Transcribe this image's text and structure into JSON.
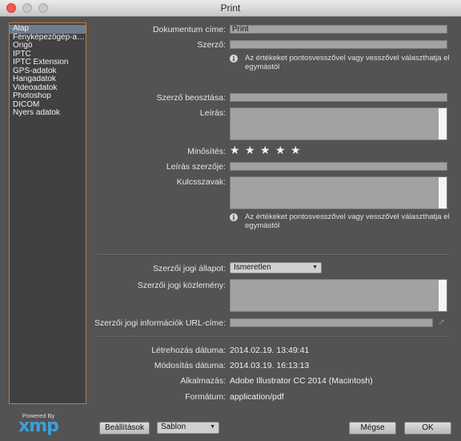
{
  "window": {
    "title": "Print"
  },
  "sidebar": {
    "items": [
      {
        "label": "Alap",
        "active": true
      },
      {
        "label": "Fényképezőgép-adatok",
        "active": false
      },
      {
        "label": "Origó",
        "active": false
      },
      {
        "label": "IPTC",
        "active": false
      },
      {
        "label": "IPTC Extension",
        "active": false
      },
      {
        "label": "GPS-adatok",
        "active": false
      },
      {
        "label": "Hangadatok",
        "active": false
      },
      {
        "label": "Videoadatok",
        "active": false
      },
      {
        "label": "Photoshop",
        "active": false
      },
      {
        "label": "DICOM",
        "active": false
      },
      {
        "label": "Nyers adatok",
        "active": false
      }
    ]
  },
  "form": {
    "doc_title_label": "Dokumentum címe:",
    "doc_title_value": "Print",
    "author_label": "Szerző:",
    "author_value": "",
    "info_text": "Az értékeket pontosvesszővel vagy vesszővel választhatja el egymástól",
    "author_title_label": "Szerző beosztása:",
    "description_label": "Leírás:",
    "rating_label": "Minősítés:",
    "rating_stars": 0,
    "rating_glyph": "★",
    "description_writer_label": "Leírás szerzője:",
    "keywords_label": "Kulcsszavak:",
    "keywords_info_text": "Az értékeket pontosvesszővel vagy vesszővel választhatja el egymástól",
    "copyright_status_label": "Szerzői jogi állapot:",
    "copyright_status_value": "Ismeretlen",
    "copyright_notice_label": "Szerzői jogi közlemény:",
    "copyright_url_label": "Szerzői jogi információk URL-címe:",
    "created_label": "Létrehozás dátuma:",
    "created_value": "2014.02.19. 13:49:41",
    "modified_label": "Módosítás dátuma:",
    "modified_value": "2014.03.19. 16:13:13",
    "app_label": "Alkalmazás:",
    "app_value": "Adobe Illustrator CC 2014 (Macintosh)",
    "format_label": "Formátum:",
    "format_value": "application/pdf"
  },
  "footer": {
    "powered_by": "Powered By",
    "xmp": "xmp",
    "settings_button": "Beállítások",
    "template_select": "Sablon",
    "cancel_button": "Mégse",
    "ok_button": "OK"
  },
  "icons": {
    "info": "i",
    "dropdown": "▼",
    "url_go": "➚"
  }
}
